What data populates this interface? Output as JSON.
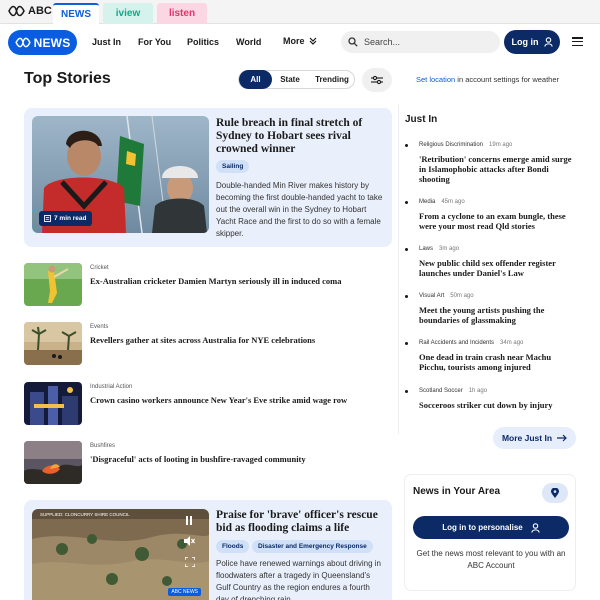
{
  "platform": {
    "logo_text": "ABC",
    "tabs": [
      {
        "label": "NEWS"
      },
      {
        "label": "iview"
      },
      {
        "label": "listen"
      }
    ]
  },
  "nav": {
    "logo_text": "NEWS",
    "links": [
      "Just In",
      "For You",
      "Politics",
      "World",
      "More"
    ],
    "search_placeholder": "Search...",
    "login_label": "Log in"
  },
  "top_stories": {
    "title": "Top Stories",
    "filters": [
      "All",
      "State",
      "Trending"
    ],
    "active_filter": "All",
    "weather_link": "Set location",
    "weather_note": " in account settings for weather"
  },
  "lead": {
    "title": "Rule breach in final stretch of Sydney to Hobart sees rival crowned winner",
    "tag": "Sailing",
    "read_time": "7 min read",
    "description": "Double-handed Min River makes history by becoming the first double-handed yacht to take out the overall win in the Sydney to Hobart Yacht Race and the first to do so with a female skipper."
  },
  "stories": [
    {
      "category": "Cricket",
      "title": "Ex-Australian cricketer Damien Martyn seriously ill in induced coma"
    },
    {
      "category": "Events",
      "title": "Revellers gather at sites across Australia for NYE celebrations"
    },
    {
      "category": "Industrial Action",
      "title": "Crown casino workers announce New Year's Eve strike amid wage row"
    },
    {
      "category": "Bushfires",
      "title": "'Disgraceful' acts of looting in bushfire-ravaged community"
    }
  ],
  "feature": {
    "title": "Praise for 'brave' officer's rescue bid as flooding claims a life",
    "tags": [
      "Floods",
      "Disaster and Emergency Response"
    ],
    "video_caption": "SUPPLIED: CLONCURRY SHIRE COUNCIL",
    "video_badge": "ABC NEWS",
    "description": "Police have renewed warnings about driving in floodwaters after a tragedy in Queensland's Gulf Country as the region endures a fourth day of drenching rain."
  },
  "just_in": {
    "title": "Just In",
    "items": [
      {
        "category": "Religious Discrimination",
        "ago": "19m ago",
        "title": "'Retribution' concerns emerge amid surge in Islamophobic attacks after Bondi shooting"
      },
      {
        "category": "Media",
        "ago": "45m ago",
        "title": "From a cyclone to an exam bungle, these were your most read Qld stories"
      },
      {
        "category": "Laws",
        "ago": "3m ago",
        "title": "New public child sex offender register launches under Daniel's Law"
      },
      {
        "category": "Visual Art",
        "ago": "50m ago",
        "title": "Meet the young artists pushing the boundaries of glassmaking"
      },
      {
        "category": "Rail Accidents and Incidents",
        "ago": "34m ago",
        "title": "One dead in train crash near Machu Picchu, tourists among injured"
      },
      {
        "category": "Scotland Soccer",
        "ago": "1h ago",
        "title": "Socceroos striker cut down by injury"
      }
    ],
    "more_label": "More Just In"
  },
  "area": {
    "title": "News in Your Area",
    "button_label": "Log in to personalise",
    "description": "Get the news most relevant to you with an ABC Account"
  },
  "colors": {
    "brand_blue": "#0a5de0",
    "navy": "#0b2a66",
    "card_bg": "#e9f0fb",
    "iview_green": "#13a88a",
    "listen_pink": "#e7336b"
  }
}
